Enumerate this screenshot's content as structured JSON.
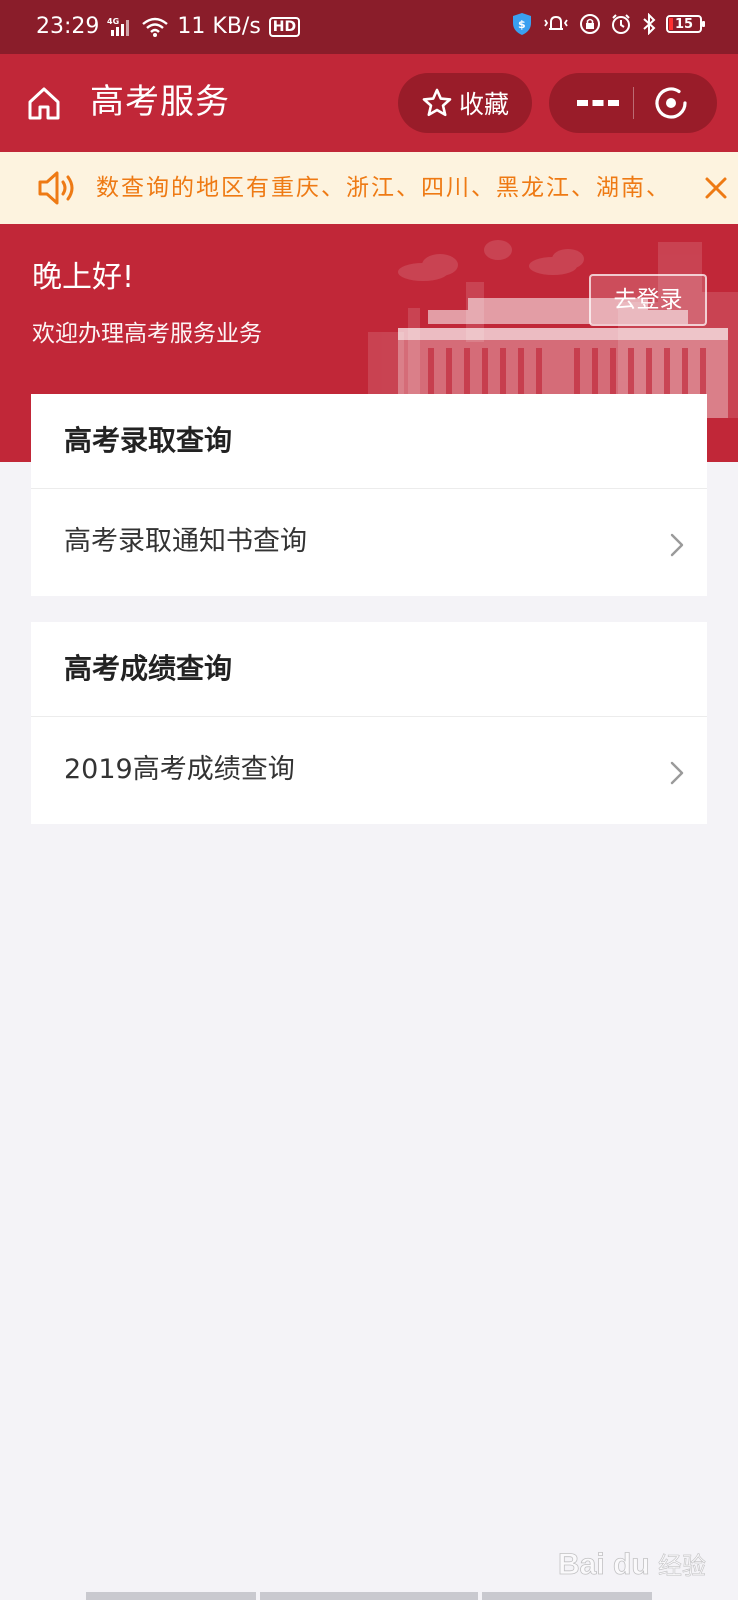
{
  "status_bar": {
    "time": "23:29",
    "network": "4G",
    "speed": "11 KB/s",
    "hd": "HD",
    "battery": "15",
    "battery_color": "#ff3030"
  },
  "nav": {
    "title": "高考服务",
    "favorite_label": "收藏",
    "icons": [
      "home-icon",
      "star-icon",
      "more-icon",
      "close-circle-icon"
    ]
  },
  "notice": {
    "text": "数查询的地区有重庆、浙江、四川、黑龙江、湖南、",
    "icons": [
      "speaker-icon",
      "close-icon"
    ]
  },
  "banner": {
    "greeting": "晚上好!",
    "welcome": "欢迎办理高考服务业务",
    "login_label": "去登录"
  },
  "sections": [
    {
      "title": "高考录取查询",
      "items": [
        {
          "label": "高考录取通知书查询"
        }
      ]
    },
    {
      "title": "高考成绩查询",
      "items": [
        {
          "label": "2019高考成绩查询"
        }
      ]
    }
  ],
  "watermark": {
    "text": "经验",
    "brand": "Bai du"
  },
  "colors": {
    "primary_red": "#c12738",
    "status_bar": "#8a1d2a",
    "notice_bg": "#fdf3df",
    "notice_text": "#ee7a14",
    "page_bg": "#f4f3f7"
  }
}
